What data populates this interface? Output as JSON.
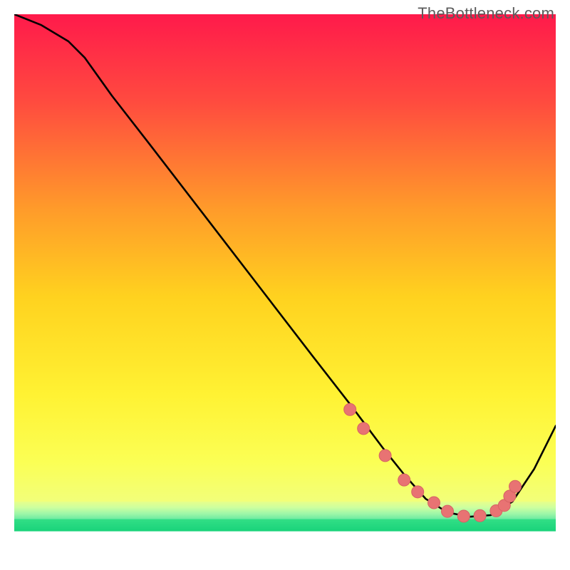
{
  "watermark": "TheBottleneck.com",
  "chart_data": {
    "type": "line",
    "title": "",
    "xlabel": "",
    "ylabel": "",
    "xlim": [
      0,
      100
    ],
    "ylim": [
      0,
      100
    ],
    "series": [
      {
        "name": "curve",
        "x": [
          0,
          5,
          10,
          13,
          18,
          25,
          35,
          45,
          55,
          62,
          68,
          72,
          76,
          80,
          84,
          88,
          92,
          96,
          100
        ],
        "y": [
          100,
          98,
          95,
          92,
          85,
          76,
          63,
          50,
          37,
          28,
          20,
          15,
          10.5,
          8,
          7.2,
          7.5,
          10,
          16,
          24
        ]
      }
    ],
    "markers": {
      "name": "points",
      "x": [
        62,
        64.5,
        68.5,
        72,
        74.5,
        77.5,
        80,
        83,
        86,
        89,
        90.5,
        91.5,
        92.5
      ],
      "y": [
        27,
        23.5,
        18.5,
        14,
        11.8,
        9.8,
        8.2,
        7.3,
        7.4,
        8.3,
        9.3,
        11,
        12.8
      ]
    },
    "gradient_bands": [
      {
        "y0": 100,
        "y1": 10,
        "stops": [
          {
            "pos": 0.0,
            "color": "#ff1a4b"
          },
          {
            "pos": 0.18,
            "color": "#ff4b3f"
          },
          {
            "pos": 0.4,
            "color": "#ff9b2a"
          },
          {
            "pos": 0.58,
            "color": "#ffd21f"
          },
          {
            "pos": 0.78,
            "color": "#fff233"
          },
          {
            "pos": 0.92,
            "color": "#fbff55"
          },
          {
            "pos": 1.0,
            "color": "#f2ff7a"
          }
        ]
      },
      {
        "y0": 10,
        "y1": 6.8,
        "stops": [
          {
            "pos": 0.0,
            "color": "#e8ff8a"
          },
          {
            "pos": 0.35,
            "color": "#ccffa0"
          },
          {
            "pos": 0.7,
            "color": "#9df7a8"
          },
          {
            "pos": 1.0,
            "color": "#6feaa1"
          }
        ]
      },
      {
        "y0": 6.8,
        "y1": 4.5,
        "stops": [
          {
            "pos": 0.0,
            "color": "#33df86"
          },
          {
            "pos": 1.0,
            "color": "#19d37a"
          }
        ]
      },
      {
        "y0": 4.5,
        "y1": 0,
        "stops": [
          {
            "pos": 0.0,
            "color": "#ffffff"
          },
          {
            "pos": 1.0,
            "color": "#ffffff"
          }
        ]
      }
    ],
    "colors": {
      "curve": "#000000",
      "marker_fill": "#e87373",
      "marker_stroke": "#d66363"
    }
  }
}
